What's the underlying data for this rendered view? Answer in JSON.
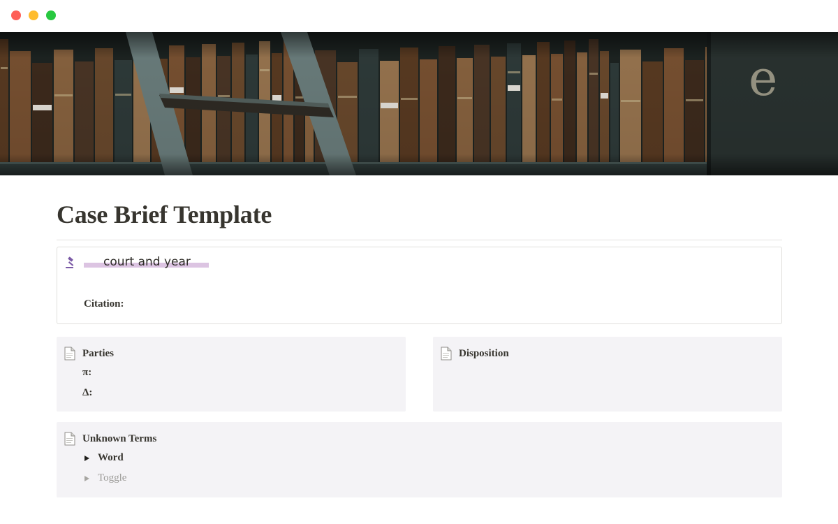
{
  "window": {
    "controls": [
      "close",
      "minimize",
      "maximize"
    ],
    "colors": {
      "close": "#fe5f57",
      "minimize": "#febc2e",
      "maximize": "#28c840"
    }
  },
  "cover": {
    "description_icon": "bookshelf-cover-image",
    "spine_letter": "e"
  },
  "page": {
    "title": "Case Brief Template"
  },
  "callout": {
    "icon": "gavel-icon",
    "court_placeholder": "court and year",
    "citation_label": "Citation:",
    "highlight_color": "#dcc4e2",
    "icon_color": "#7b5aa6"
  },
  "parties": {
    "icon": "document-icon",
    "heading": "Parties",
    "plaintiff_label": "π:",
    "defendant_label": "Δ:"
  },
  "disposition": {
    "icon": "document-icon",
    "heading": "Disposition"
  },
  "unknown_terms": {
    "icon": "document-icon",
    "heading": "Unknown Terms",
    "toggles": [
      {
        "label": "Word"
      },
      {
        "label": "Toggle"
      }
    ]
  },
  "colors": {
    "panel_bg": "#f4f3f6",
    "text": "#37352f",
    "muted": "#9b9a97"
  }
}
